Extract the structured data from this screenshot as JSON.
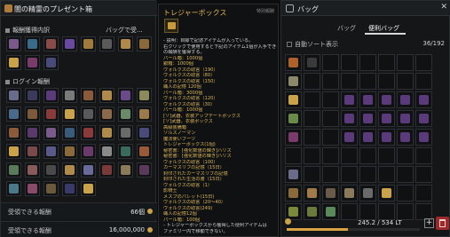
{
  "left": {
    "title": "闇の精霊のプレゼント箱",
    "section1": "報酬獲得内訳",
    "bag_link": "バッグで受...",
    "section2": "ログイン報酬",
    "footer1": {
      "label": "受領できる報酬",
      "value": "66個"
    },
    "footer2": {
      "label": "受領できる報酬",
      "value": "16,000,000"
    }
  },
  "tooltip": {
    "title": "トレジャーボックス",
    "corner": "特別報酬",
    "lines": [
      "- 説明：目録で記述アイテムが入っている。",
      "右クリックで使用すると下記のアイテム1個が入手できる。ランダム",
      "の報酬を獲得する。",
      "パール箱：1000個",
      "銀箱：1000個",
      "ヴォルクスの助言（190）",
      "ヴォルクスの助言（80）",
      "ヴォルクスの助言（150）",
      "職人の記憶 120個",
      "パール箱：3000個",
      "ヴォルクスの助言（120）",
      "ヴォルクスの助言（30）",
      "パール箱：1000個",
      "[ソ]武器、衣装アップデートボックス",
      "[ソ]武器、衣装ボックス",
      "高級装備箱",
      "ソルスノーマン",
      "魔法使いブーツ",
      "トレジャーボックス(1個)",
      "秘密書：[強化数値の輝き]ハリス",
      "秘密書：[強化数値の輝き]ハリス",
      "ヴォルクスの助言（100）",
      "カーマスリブの記憶（15日）",
      "封印されたカーマスリブの記憶",
      "封印された生活の書（15日）",
      "ヴォルクスの助言（1）",
      "影騎士",
      "メスプのパレット(15日)",
      "ヴォルクスの助言（20～40）",
      "ヴォルクスの助言(249)",
      "職人の記憶12個",
      "パール箱：100個",
      "- トレジャーボックスから獲得した便利アイテムは",
      "ファミリー内で移動できない。"
    ]
  },
  "right": {
    "title": "バッグ",
    "tabs": [
      "バッグ",
      "便利バッグ"
    ],
    "auto_sort": "自動ソート表示",
    "capacity": "36/192",
    "weight": "245.2 / 534 LT",
    "weight_fraction": 0.46
  },
  "colors": {
    "accent": "#e2b456",
    "panel": "#141618",
    "trash": "#9d2a2a"
  }
}
